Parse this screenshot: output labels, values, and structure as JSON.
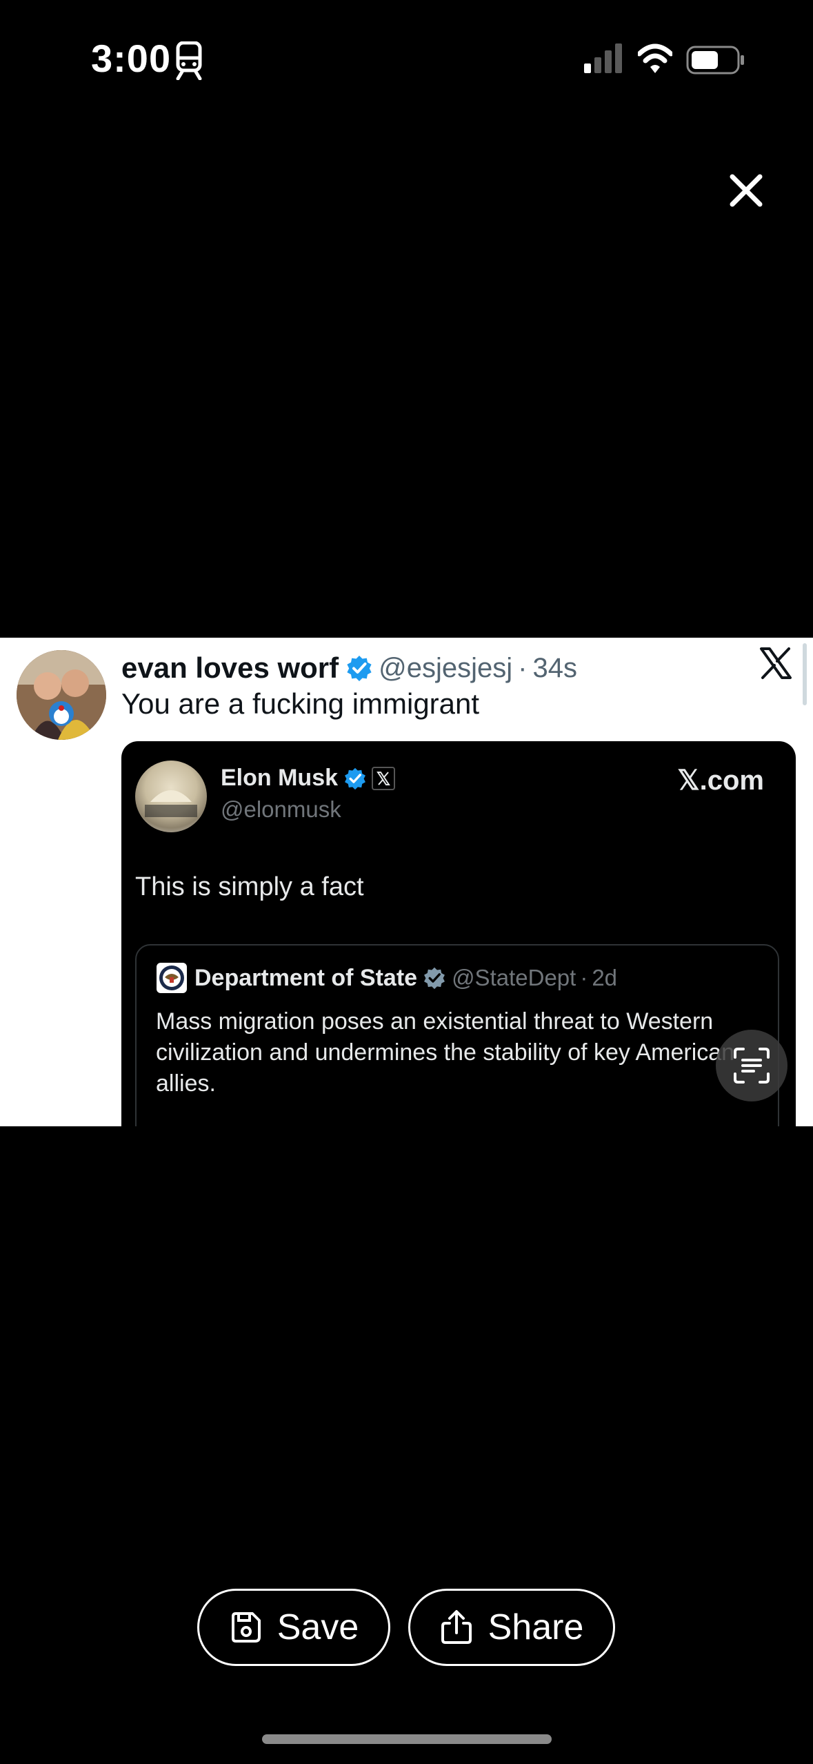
{
  "status_bar": {
    "time": "3:00",
    "icons": [
      "transit-icon",
      "signal-icon",
      "wifi-icon",
      "battery-icon"
    ]
  },
  "viewer": {
    "close_icon": "close-icon"
  },
  "tweet": {
    "author_name": "evan loves worf",
    "author_handle": "@esjesjesj",
    "separator": "·",
    "time": "34s",
    "text": "You are a fucking immigrant",
    "embed": {
      "author_name": "Elon Musk",
      "author_handle": "@elonmusk",
      "site": "𝕏.com",
      "text": "This is simply a fact",
      "quote": {
        "author_name": "Department of State",
        "author_handle": "@StateDept",
        "separator": "·",
        "time": "2d",
        "text": "Mass migration poses an existential threat to Western civilization and undermines the stability of key American allies."
      }
    }
  },
  "actions": {
    "save_label": "Save",
    "share_label": "Share"
  },
  "colors": {
    "verified_blue": "#1d9bf0",
    "background": "#000000"
  }
}
